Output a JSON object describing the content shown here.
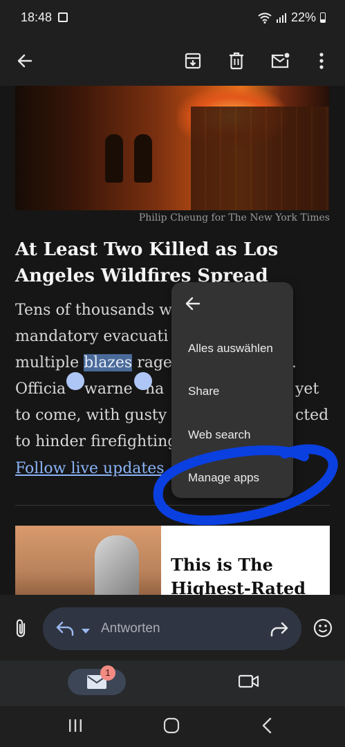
{
  "status_bar": {
    "time": "18:48",
    "battery_percent": "22%"
  },
  "article": {
    "photo_credit": "Philip Cheung for The New York Times",
    "headline_line1": "At Least Two Killed as Los",
    "headline_line2": "Angeles Wildfires Spread",
    "body_line1": "Tens of thousands w",
    "body_line2": "mandatory evacuati",
    "body_line3_pre": "multiple ",
    "body_line3_sel": "blazes",
    "body_line3_post": " rage",
    "body_line3_tail": ".",
    "body_line4a": "Officia",
    "body_line4b": "warne",
    "body_line4c": "ha",
    "body_line4d": "yet",
    "body_line5a": "to come, with gusty ",
    "body_line5b": "cted",
    "body_line6": "to hinder firefighting",
    "link": "Follow live updates"
  },
  "ad": {
    "line1": "This is The",
    "line2": "Highest-Rated"
  },
  "context_menu": {
    "items": [
      "Alles auswählen",
      "Share",
      "Web search",
      "Manage apps"
    ]
  },
  "reply": {
    "placeholder": "Antworten"
  },
  "nav": {
    "mail_badge": "1"
  },
  "colors": {
    "annotation": "#0a3fe0",
    "accent": "#8ab4f8"
  }
}
